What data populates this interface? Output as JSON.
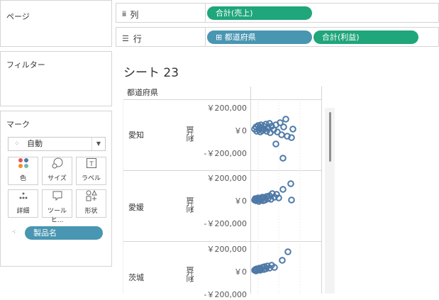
{
  "left_panes": {
    "pages_title": "ページ",
    "filters_title": "フィルター",
    "marks_title": "マーク",
    "mark_type": "自動",
    "mark_buttons": [
      {
        "label": "色",
        "icon": "color-dots-icon"
      },
      {
        "label": "サイズ",
        "icon": "size-icon"
      },
      {
        "label": "ラベル",
        "icon": "label-icon"
      },
      {
        "label": "詳細",
        "icon": "detail-icon"
      },
      {
        "label": "ツールヒ...",
        "icon": "tooltip-icon"
      },
      {
        "label": "形状",
        "icon": "shape-icon"
      }
    ],
    "detail_pill": "製品名"
  },
  "shelves": {
    "columns_label": "列",
    "columns_pills": [
      "合計(売上)"
    ],
    "rows_label": "行",
    "rows_pills": [
      "⊞ 都道府県",
      "合計(利益)"
    ]
  },
  "sheet": {
    "title": "シート 23",
    "row_header": "都道府県",
    "axis_title": "利益",
    "tick_labels": [
      "￥200,000",
      "￥0",
      "-￥200,000"
    ],
    "rows": [
      "愛知",
      "愛媛",
      "茨城"
    ]
  },
  "colors": {
    "green_pill": "#1fa67a",
    "blue_pill": "#4996b2",
    "mark": "#4e79a7"
  }
}
